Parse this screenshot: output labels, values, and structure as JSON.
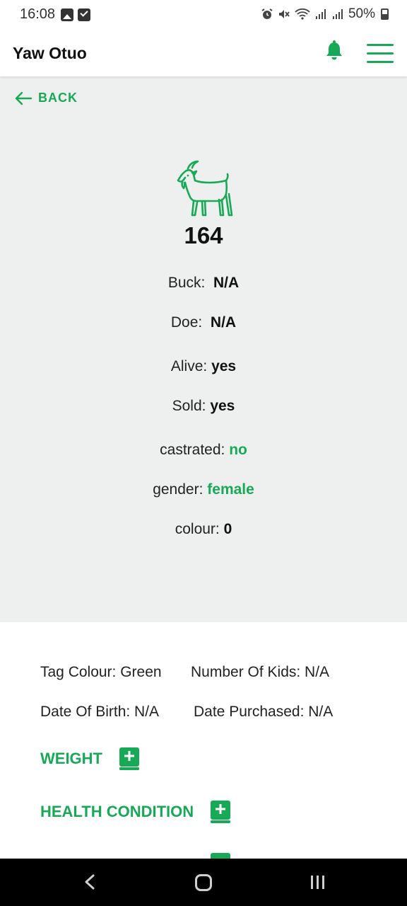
{
  "status_bar": {
    "time": "16:08",
    "battery": "50%",
    "icons": [
      "image-icon",
      "check-square-icon",
      "alarm-icon",
      "mute-icon",
      "wifi-icon",
      "signal-icon",
      "signal-icon",
      "battery-icon"
    ]
  },
  "header": {
    "user_name": "Yaw Otuo",
    "accent_color": "#18a957"
  },
  "detail": {
    "back_label": "BACK",
    "goat_id": "164",
    "buck_label": "Buck:",
    "buck_value": "N/A",
    "doe_label": "Doe:",
    "doe_value": "N/A",
    "alive_label": "Alive:",
    "alive_value": "yes",
    "sold_label": "Sold:",
    "sold_value": "yes",
    "castrated_label": "castrated:",
    "castrated_value": "no",
    "gender_label": "gender:",
    "gender_value": "female",
    "colour_label": "colour:",
    "colour_value": "0"
  },
  "meta": {
    "tag_colour": "Tag Colour: Green",
    "number_of_kids": "Number Of Kids: N/A",
    "date_of_birth": "Date Of Birth: N/A",
    "date_purchased": "Date Purchased: N/A"
  },
  "sections": {
    "weight_label": "WEIGHT",
    "health_label": "HEALTH CONDITION"
  }
}
